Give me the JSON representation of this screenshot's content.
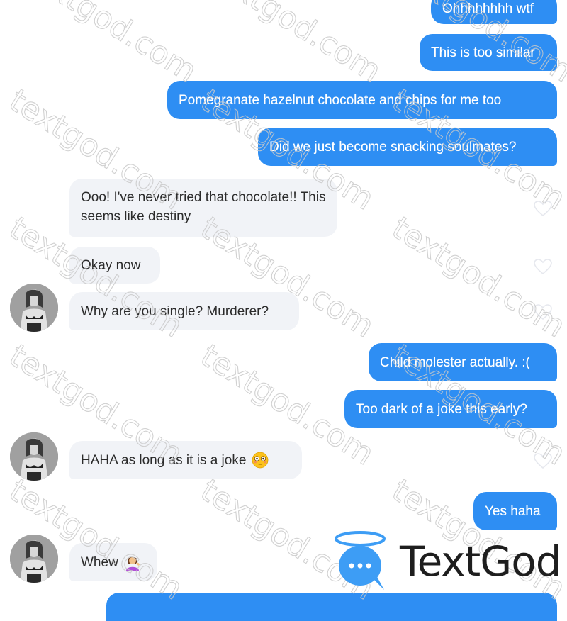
{
  "conversation": {
    "messages": [
      {
        "from": "me",
        "text": "Ohhhhhhhh wtf"
      },
      {
        "from": "me",
        "text": "This is too similar"
      },
      {
        "from": "me",
        "text": "Pomegranate hazelnut chocolate and chips for me too"
      },
      {
        "from": "me",
        "text": "Did we just become snacking soulmates?"
      },
      {
        "from": "match",
        "text": "Ooo! I've never tried that chocolate!! This seems like destiny"
      },
      {
        "from": "match",
        "text": "Okay now"
      },
      {
        "from": "match",
        "text": "Why are you single? Murderer?"
      },
      {
        "from": "me",
        "text": "Child molester actually. :("
      },
      {
        "from": "me",
        "text": "Too dark of a joke this early?"
      },
      {
        "from": "match",
        "text": "HAHA as long as it is a joke",
        "emoji": "flushed-face-emoji"
      },
      {
        "from": "me",
        "text": "Yes haha"
      },
      {
        "from": "match",
        "text": "Whew",
        "emoji": "person-tipping-hand-emoji"
      }
    ]
  },
  "watermark": {
    "text": "textgod.com"
  },
  "brand": {
    "name": "TextGod",
    "icon": "halo-chat-bubble-icon"
  },
  "colors": {
    "sent_bubble": "#2e8ef3",
    "received_bubble": "#f1f3f7",
    "received_text": "#2b2b2b",
    "brand_icon": "#3d9df5"
  }
}
